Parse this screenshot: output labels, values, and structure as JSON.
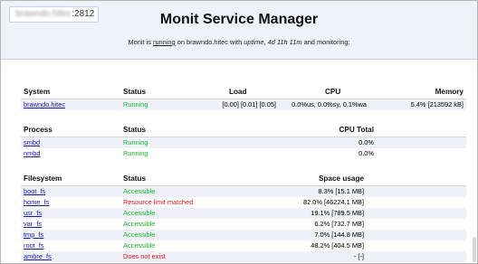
{
  "header": {
    "host_hidden": "brawndo.hitec",
    "host_port": ":2812",
    "title": "Monit Service Manager",
    "status_line": {
      "prefix": "Monit is",
      "running_link": "running",
      "on": "on brawndo.hitec with",
      "uptime_label": "uptime,",
      "uptime_value": "4d 11h 11m",
      "suffix": "and monitoring:"
    }
  },
  "system": {
    "headers": {
      "name": "System",
      "status": "Status",
      "load": "Load",
      "cpu": "CPU",
      "memory": "Memory"
    },
    "rows": [
      {
        "name": "brawndo.hitec",
        "status": "Running",
        "load": "[0.00] [0.01] [0.05]",
        "cpu": "0.0%us, 0.0%sy, 0.1%wa",
        "memory": "5.4% [213592 kB]"
      }
    ]
  },
  "process": {
    "headers": {
      "name": "Process",
      "status": "Status",
      "cpu_total": "CPU Total"
    },
    "rows": [
      {
        "name": "smbd",
        "status": "Running",
        "cpu_total": "0.0%"
      },
      {
        "name": "nmbd",
        "status": "Running",
        "cpu_total": "0.0%"
      }
    ]
  },
  "filesystem": {
    "headers": {
      "name": "Filesystem",
      "status": "Status",
      "space": "Space usage"
    },
    "rows": [
      {
        "name": "boot_fs",
        "status": "Accessible",
        "state": "ok",
        "space": "8.3% [15.1 MB]"
      },
      {
        "name": "home_fs",
        "status": "Resource limit matched",
        "state": "bad",
        "space": "82.0% [46224.1 MB]"
      },
      {
        "name": "usr_fs",
        "status": "Accessible",
        "state": "ok",
        "space": "19.1% [789.5 MB]"
      },
      {
        "name": "var_fs",
        "status": "Accessible",
        "state": "ok",
        "space": "6.2% [732.7 MB]"
      },
      {
        "name": "tmp_fs",
        "status": "Accessible",
        "state": "ok",
        "space": "7.0% [144.8 MB]"
      },
      {
        "name": "root_fs",
        "status": "Accessible",
        "state": "ok",
        "space": "48.2% [404.5 MB]"
      },
      {
        "name": "ambre_fs",
        "status": "Does not exist",
        "state": "bad",
        "space": "- [-]"
      }
    ]
  },
  "colors": {
    "ok": "#16b52a",
    "bad": "#e0161b",
    "link": "#1a1aa6",
    "header_bg": "#eef3fa"
  }
}
